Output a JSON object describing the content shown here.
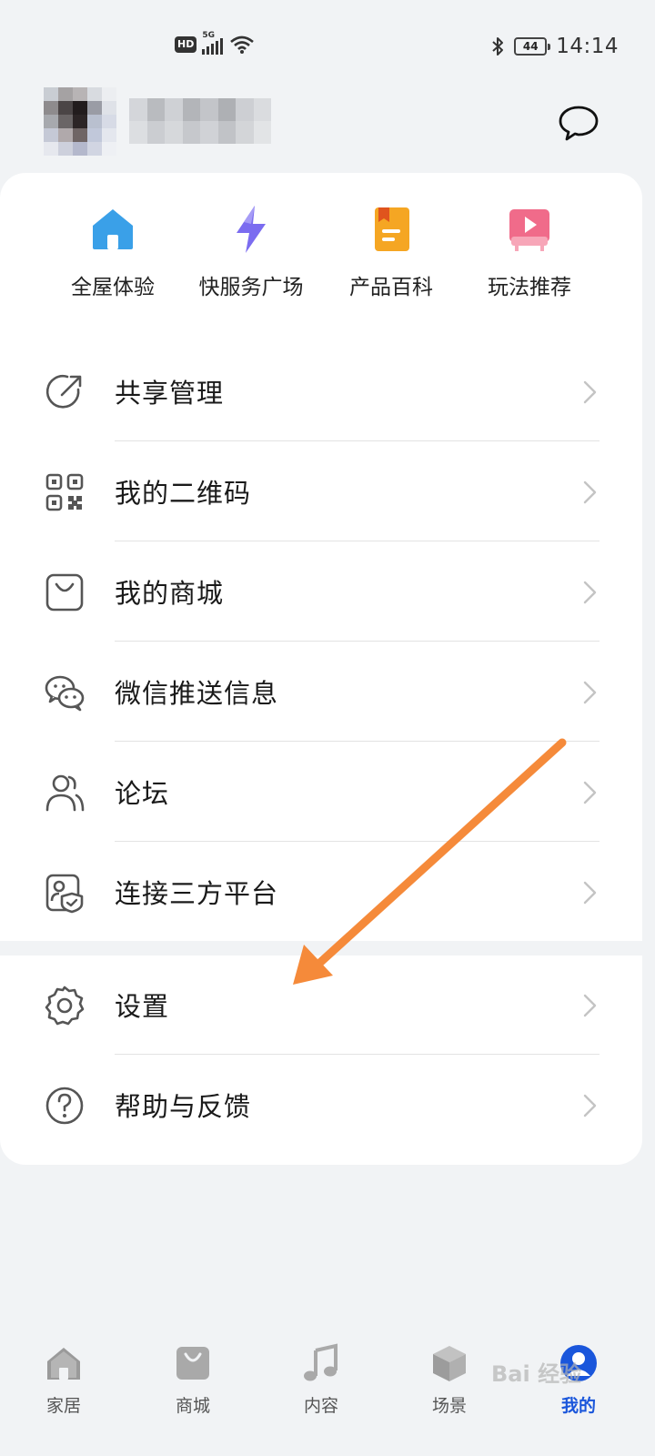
{
  "status_bar": {
    "hd": "HD",
    "network": "5G",
    "battery": "44",
    "time": "14:14"
  },
  "quick_actions": [
    {
      "label": "全屋体验",
      "icon": "home-icon",
      "color": "#3aa0e8"
    },
    {
      "label": "快服务广场",
      "icon": "lightning-icon",
      "color": "#7b6cf0"
    },
    {
      "label": "产品百科",
      "icon": "book-icon",
      "color": "#f5a623"
    },
    {
      "label": "玩法推荐",
      "icon": "video-play-icon",
      "color": "#f06b8a"
    }
  ],
  "menu": [
    {
      "label": "共享管理",
      "icon": "share-icon"
    },
    {
      "label": "我的二维码",
      "icon": "qr-code-icon"
    },
    {
      "label": "我的商城",
      "icon": "shopping-bag-icon"
    },
    {
      "label": "微信推送信息",
      "icon": "wechat-icon"
    },
    {
      "label": "论坛",
      "icon": "people-icon"
    },
    {
      "label": "连接三方平台",
      "icon": "shield-link-icon"
    }
  ],
  "menu2": [
    {
      "label": "设置",
      "icon": "gear-icon"
    },
    {
      "label": "帮助与反馈",
      "icon": "help-icon"
    }
  ],
  "bottom_nav": [
    {
      "label": "家居",
      "icon": "home-icon"
    },
    {
      "label": "商城",
      "icon": "shopping-bag-icon"
    },
    {
      "label": "内容",
      "icon": "music-note-icon"
    },
    {
      "label": "场景",
      "icon": "cube-icon"
    },
    {
      "label": "我的",
      "icon": "user-icon",
      "active": true
    }
  ],
  "watermark": "Bai 经验",
  "accent_color": "#1a56db",
  "arrow_color": "#f58a3a"
}
